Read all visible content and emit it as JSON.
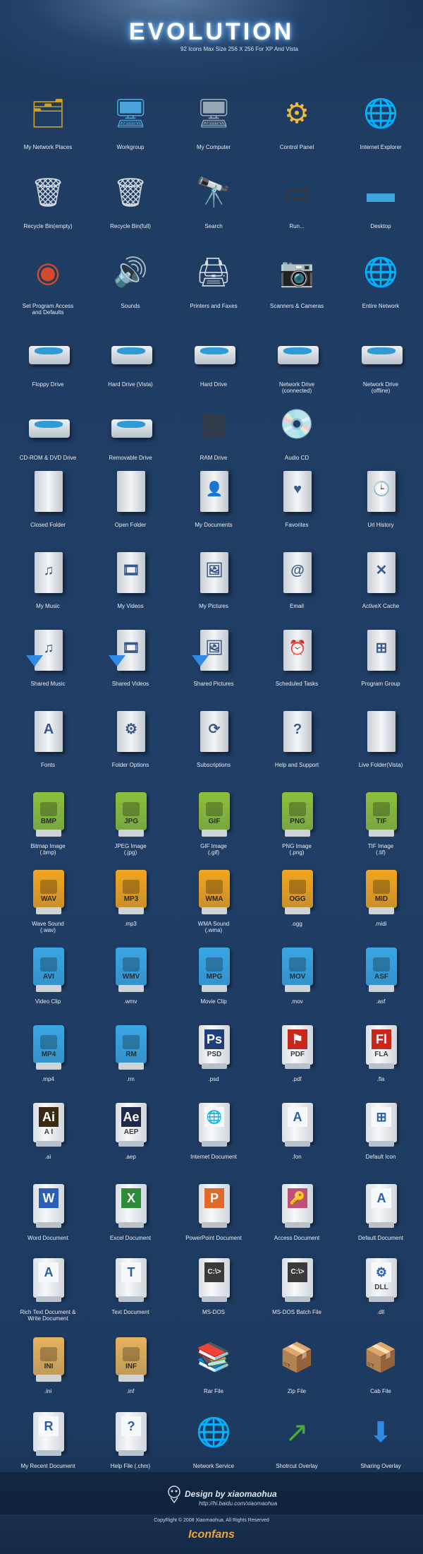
{
  "header": {
    "title": "EVOLUTION",
    "subtitle": "92 Icons Max Size 256 X 256 For  XP And Vista"
  },
  "rows": [
    {
      "items": [
        {
          "label": "My Network Places",
          "icon": "network-places-icon",
          "kind": "glyph",
          "glyph": "🗂",
          "color": "#d4a21f"
        },
        {
          "label": "Workgroup",
          "icon": "workgroup-icon",
          "kind": "glyph",
          "glyph": "🖥",
          "color": "#4aa3d9"
        },
        {
          "label": "My Computer",
          "icon": "computer-icon",
          "kind": "glyph",
          "glyph": "🖥",
          "color": "#9aa7b5"
        },
        {
          "label": "Control Panel",
          "icon": "control-panel-icon",
          "kind": "glyph",
          "glyph": "⚙",
          "color": "#f0b93a"
        },
        {
          "label": "Internet Explorer",
          "icon": "internet-explorer-icon",
          "kind": "glyph",
          "glyph": "🌐",
          "color": "#3a8fd6"
        }
      ]
    },
    {
      "items": [
        {
          "label": "Recycle Bin(empty)",
          "icon": "recycle-bin-empty-icon",
          "kind": "glyph",
          "glyph": "🗑",
          "color": "#cfd6de"
        },
        {
          "label": "Recycle Bin(full)",
          "icon": "recycle-bin-full-icon",
          "kind": "glyph",
          "glyph": "🗑",
          "color": "#cfd6de"
        },
        {
          "label": "Search",
          "icon": "binoculars-icon",
          "kind": "glyph",
          "glyph": "🔭",
          "color": "#c7cdd3"
        },
        {
          "label": "Run...",
          "icon": "run-icon",
          "kind": "glyph",
          "glyph": "▭",
          "color": "#3a3a3a"
        },
        {
          "label": "Desktop",
          "icon": "desktop-icon",
          "kind": "glyph",
          "glyph": "▬",
          "color": "#3fa5e0"
        }
      ]
    },
    {
      "items": [
        {
          "label": "Set Program Access\nand Defaults",
          "icon": "program-access-icon",
          "kind": "glyph",
          "glyph": "◉",
          "color": "#d44a2a"
        },
        {
          "label": "Sounds",
          "icon": "speaker-icon",
          "kind": "glyph",
          "glyph": "🔊",
          "color": "#9aa1a8"
        },
        {
          "label": "Printers and Faxes",
          "icon": "printer-icon",
          "kind": "glyph",
          "glyph": "🖨",
          "color": "#d5dbe1"
        },
        {
          "label": "Scanners & Cameras",
          "icon": "camera-icon",
          "kind": "glyph",
          "glyph": "📷",
          "color": "#c8ced4"
        },
        {
          "label": "Entire Network",
          "icon": "globe-icon",
          "kind": "glyph",
          "glyph": "🌐",
          "color": "#3a8fd6"
        }
      ]
    },
    {
      "items": [
        {
          "label": "Floppy Drive",
          "icon": "floppy-drive-icon",
          "kind": "drive"
        },
        {
          "label": "Hard Drive (Vista)",
          "icon": "hard-drive-vista-icon",
          "kind": "drive"
        },
        {
          "label": "Hard Drive",
          "icon": "hard-drive-icon",
          "kind": "drive"
        },
        {
          "label": "Network Drive\n(connected)",
          "icon": "network-drive-connected-icon",
          "kind": "drive"
        },
        {
          "label": "Network Drive\n(offline)",
          "icon": "network-drive-offline-icon",
          "kind": "drive"
        }
      ]
    },
    {
      "items": [
        {
          "label": "CD-ROM & DVD Drive",
          "icon": "cdrom-drive-icon",
          "kind": "drive"
        },
        {
          "label": "Removable Drive",
          "icon": "removable-drive-icon",
          "kind": "drive"
        },
        {
          "label": "RAM Drive",
          "icon": "ram-chip-icon",
          "kind": "glyph",
          "glyph": "▦",
          "color": "#3a3a3a"
        },
        {
          "label": "Audio CD",
          "icon": "audio-cd-icon",
          "kind": "glyph",
          "glyph": "💿",
          "color": "#c9cfd6"
        }
      ]
    },
    {
      "items": [
        {
          "label": "Closed Folder",
          "icon": "closed-folder-icon",
          "kind": "folder",
          "sym": ""
        },
        {
          "label": "Open Folder",
          "icon": "open-folder-icon",
          "kind": "folder",
          "sym": ""
        },
        {
          "label": "My Documents",
          "icon": "my-documents-icon",
          "kind": "folder",
          "sym": "👤"
        },
        {
          "label": "Favorites",
          "icon": "favorites-icon",
          "kind": "folder",
          "sym": "♥"
        },
        {
          "label": "Url History",
          "icon": "url-history-icon",
          "kind": "folder",
          "sym": "🕒"
        }
      ]
    },
    {
      "items": [
        {
          "label": "My Music",
          "icon": "my-music-icon",
          "kind": "folder",
          "sym": "♫"
        },
        {
          "label": "My Videos",
          "icon": "my-videos-icon",
          "kind": "folder",
          "sym": "🎞"
        },
        {
          "label": "My Pictures",
          "icon": "my-pictures-icon",
          "kind": "folder",
          "sym": "🖼"
        },
        {
          "label": "Email",
          "icon": "email-icon",
          "kind": "folder",
          "sym": "@"
        },
        {
          "label": "ActiveX Cache",
          "icon": "activex-cache-icon",
          "kind": "folder",
          "sym": "✕"
        }
      ]
    },
    {
      "items": [
        {
          "label": "Shared Music",
          "icon": "shared-music-icon",
          "kind": "folder",
          "sym": "♫",
          "arrow": true
        },
        {
          "label": "Shared Videos",
          "icon": "shared-videos-icon",
          "kind": "folder",
          "sym": "🎞",
          "arrow": true
        },
        {
          "label": "Shared Pictures",
          "icon": "shared-pictures-icon",
          "kind": "folder",
          "sym": "🖼",
          "arrow": true
        },
        {
          "label": "Scheduled Tasks",
          "icon": "scheduled-tasks-icon",
          "kind": "folder",
          "sym": "⏰"
        },
        {
          "label": "Program Group",
          "icon": "program-group-icon",
          "kind": "folder",
          "sym": "⊞"
        }
      ]
    },
    {
      "items": [
        {
          "label": "Fonts",
          "icon": "fonts-icon",
          "kind": "folder",
          "sym": "A"
        },
        {
          "label": "Folder Options",
          "icon": "folder-options-icon",
          "kind": "folder",
          "sym": "⚙"
        },
        {
          "label": "Subscriptions",
          "icon": "subscriptions-icon",
          "kind": "folder",
          "sym": "⟳"
        },
        {
          "label": "Help and Support",
          "icon": "help-support-icon",
          "kind": "folder",
          "sym": "?"
        },
        {
          "label": "Live Folder(Vista)",
          "icon": "live-folder-icon",
          "kind": "folder",
          "sym": ""
        }
      ]
    },
    {
      "items": [
        {
          "label": "Bitmap Image\n(.bmp)",
          "icon": "bmp-file-icon",
          "kind": "cfile",
          "ext": "BMP",
          "color": "#8dbf3a"
        },
        {
          "label": "JPEG Image\n(.jpg)",
          "icon": "jpg-file-icon",
          "kind": "cfile",
          "ext": "JPG",
          "color": "#8dbf3a"
        },
        {
          "label": "GIF Image\n(.gif)",
          "icon": "gif-file-icon",
          "kind": "cfile",
          "ext": "GIF",
          "color": "#8dbf3a"
        },
        {
          "label": "PNG Image\n(.png)",
          "icon": "png-file-icon",
          "kind": "cfile",
          "ext": "PNG",
          "color": "#8dbf3a"
        },
        {
          "label": "TIF Image\n(.tif)",
          "icon": "tif-file-icon",
          "kind": "cfile",
          "ext": "TIF",
          "color": "#8dbf3a"
        }
      ]
    },
    {
      "items": [
        {
          "label": "Wave Sound\n(.wav)",
          "icon": "wav-file-icon",
          "kind": "cfile",
          "ext": "WAV",
          "color": "#f2a51e"
        },
        {
          "label": ".mp3",
          "icon": "mp3-file-icon",
          "kind": "cfile",
          "ext": "MP3",
          "color": "#f2a51e"
        },
        {
          "label": "WMA Sound\n(.wma)",
          "icon": "wma-file-icon",
          "kind": "cfile",
          "ext": "WMA",
          "color": "#f2a51e"
        },
        {
          "label": ".ogg",
          "icon": "ogg-file-icon",
          "kind": "cfile",
          "ext": "OGG",
          "color": "#f2a51e"
        },
        {
          "label": ".midi",
          "icon": "midi-file-icon",
          "kind": "cfile",
          "ext": "MID",
          "color": "#f2a51e"
        }
      ]
    },
    {
      "items": [
        {
          "label": "Video Clip",
          "icon": "avi-file-icon",
          "kind": "cfile",
          "ext": "AVI",
          "color": "#3aa6e4"
        },
        {
          "label": ".wmv",
          "icon": "wmv-file-icon",
          "kind": "cfile",
          "ext": "WMV",
          "color": "#3aa6e4"
        },
        {
          "label": "Movie Clip",
          "icon": "mpg-file-icon",
          "kind": "cfile",
          "ext": "MPG",
          "color": "#3aa6e4"
        },
        {
          "label": ".mov",
          "icon": "mov-file-icon",
          "kind": "cfile",
          "ext": "MOV",
          "color": "#3aa6e4"
        },
        {
          "label": ".asf",
          "icon": "asf-file-icon",
          "kind": "cfile",
          "ext": "ASF",
          "color": "#3aa6e4"
        }
      ]
    },
    {
      "items": [
        {
          "label": ".mp4",
          "icon": "mp4-file-icon",
          "kind": "cfile",
          "ext": "MP4",
          "color": "#3aa6e4"
        },
        {
          "label": ".rm",
          "icon": "rm-file-icon",
          "kind": "cfile",
          "ext": "RM",
          "color": "#3aa6e4"
        },
        {
          "label": ".psd",
          "icon": "psd-file-icon",
          "kind": "doc",
          "ext": "PSD",
          "sym": "Ps",
          "color": "#1f3f7a"
        },
        {
          "label": ".pdf",
          "icon": "pdf-file-icon",
          "kind": "doc",
          "ext": "PDF",
          "sym": "⚑",
          "color": "#c8281c"
        },
        {
          "label": ".fla",
          "icon": "fla-file-icon",
          "kind": "doc",
          "ext": "FLA",
          "sym": "Fl",
          "color": "#c8281c"
        }
      ]
    },
    {
      "items": [
        {
          "label": ".ai",
          "icon": "ai-file-icon",
          "kind": "doc",
          "ext": "A I",
          "sym": "Ai",
          "color": "#3a2a14"
        },
        {
          "label": ".aep",
          "icon": "aep-file-icon",
          "kind": "doc",
          "ext": "AEP",
          "sym": "Ae",
          "color": "#1f2a4a"
        },
        {
          "label": "Internet Document",
          "icon": "internet-document-icon",
          "kind": "doc",
          "ext": "",
          "sym": "🌐",
          "color": "#f7f8fa"
        },
        {
          "label": ".fon",
          "icon": "fon-file-icon",
          "kind": "doc",
          "ext": "",
          "sym": "A",
          "color": "#f7f8fa"
        },
        {
          "label": "Default Icon",
          "icon": "default-icon",
          "kind": "doc",
          "ext": "",
          "sym": "⊞",
          "color": "#f7f8fa"
        }
      ]
    },
    {
      "items": [
        {
          "label": "Word Document",
          "icon": "word-document-icon",
          "kind": "doc",
          "ext": "",
          "sym": "W",
          "color": "#2b5fb5"
        },
        {
          "label": "Excel Document",
          "icon": "excel-document-icon",
          "kind": "doc",
          "ext": "",
          "sym": "X",
          "color": "#2e8b3a"
        },
        {
          "label": "PowerPoint Document",
          "icon": "powerpoint-document-icon",
          "kind": "doc",
          "ext": "",
          "sym": "P",
          "color": "#e06a2a"
        },
        {
          "label": "Access Document",
          "icon": "access-document-icon",
          "kind": "doc",
          "ext": "",
          "sym": "🔑",
          "color": "#c0507a"
        },
        {
          "label": "Default Document",
          "icon": "default-document-icon",
          "kind": "doc",
          "ext": "",
          "sym": "A",
          "color": "#f7f8fa"
        }
      ]
    },
    {
      "items": [
        {
          "label": "Rich Text Document &\nWrite Document",
          "icon": "rich-text-document-icon",
          "kind": "doc",
          "ext": "",
          "sym": "A",
          "color": "#f7f8fa"
        },
        {
          "label": "Text Document",
          "icon": "text-document-icon",
          "kind": "doc",
          "ext": "",
          "sym": "T",
          "color": "#f7f8fa"
        },
        {
          "label": "MS-DOS",
          "icon": "msdos-icon",
          "kind": "doc",
          "ext": "",
          "sym": "C:\\>",
          "color": "#3a3a3a"
        },
        {
          "label": "MS-DOS Batch File",
          "icon": "msdos-batch-icon",
          "kind": "doc",
          "ext": "",
          "sym": "C:\\>",
          "color": "#3a3a3a"
        },
        {
          "label": ".dll",
          "icon": "dll-file-icon",
          "kind": "doc",
          "ext": "DLL",
          "sym": "⚙",
          "color": "#f7f8fa"
        }
      ]
    },
    {
      "items": [
        {
          "label": ".ini",
          "icon": "ini-file-icon",
          "kind": "cfile",
          "ext": "INI",
          "color": "#e7b25a"
        },
        {
          "label": ".inf",
          "icon": "inf-file-icon",
          "kind": "cfile",
          "ext": "INF",
          "color": "#e7b25a"
        },
        {
          "label": "Rar File",
          "icon": "rar-file-icon",
          "kind": "glyph",
          "glyph": "📚",
          "color": "#7a2a6a"
        },
        {
          "label": "Zip File",
          "icon": "zip-file-icon",
          "kind": "glyph",
          "glyph": "📦",
          "color": "#e58a1e"
        },
        {
          "label": "Cab File",
          "icon": "cab-file-icon",
          "kind": "glyph",
          "glyph": "📦",
          "color": "#c9cfd6"
        }
      ]
    },
    {
      "items": [
        {
          "label": "My Recent Document",
          "icon": "recent-document-icon",
          "kind": "doc",
          "ext": "",
          "sym": "R",
          "color": "#f7f8fa"
        },
        {
          "label": "Help File (.chm)",
          "icon": "help-file-icon",
          "kind": "doc",
          "ext": "",
          "sym": "?",
          "color": "#f7f8fa"
        },
        {
          "label": "Network Service",
          "icon": "network-service-icon",
          "kind": "glyph",
          "glyph": "🌐",
          "color": "#3a8fd6"
        },
        {
          "label": "Shotrcut Overlay",
          "icon": "shortcut-overlay-icon",
          "kind": "glyph",
          "glyph": "↗",
          "color": "#4caa3a"
        },
        {
          "label": "Sharing Overlay",
          "icon": "sharing-overlay-icon",
          "kind": "glyph",
          "glyph": "⬇",
          "color": "#2f8ae6"
        }
      ]
    }
  ],
  "footer": {
    "design": "Design by xiaomaohua",
    "url": "http://hi.baidu.com/xiaomaohua",
    "copyright": "CopyRight © 2008 Xiaomaohua. All Rights Reserved",
    "logo": "Iconfans"
  }
}
